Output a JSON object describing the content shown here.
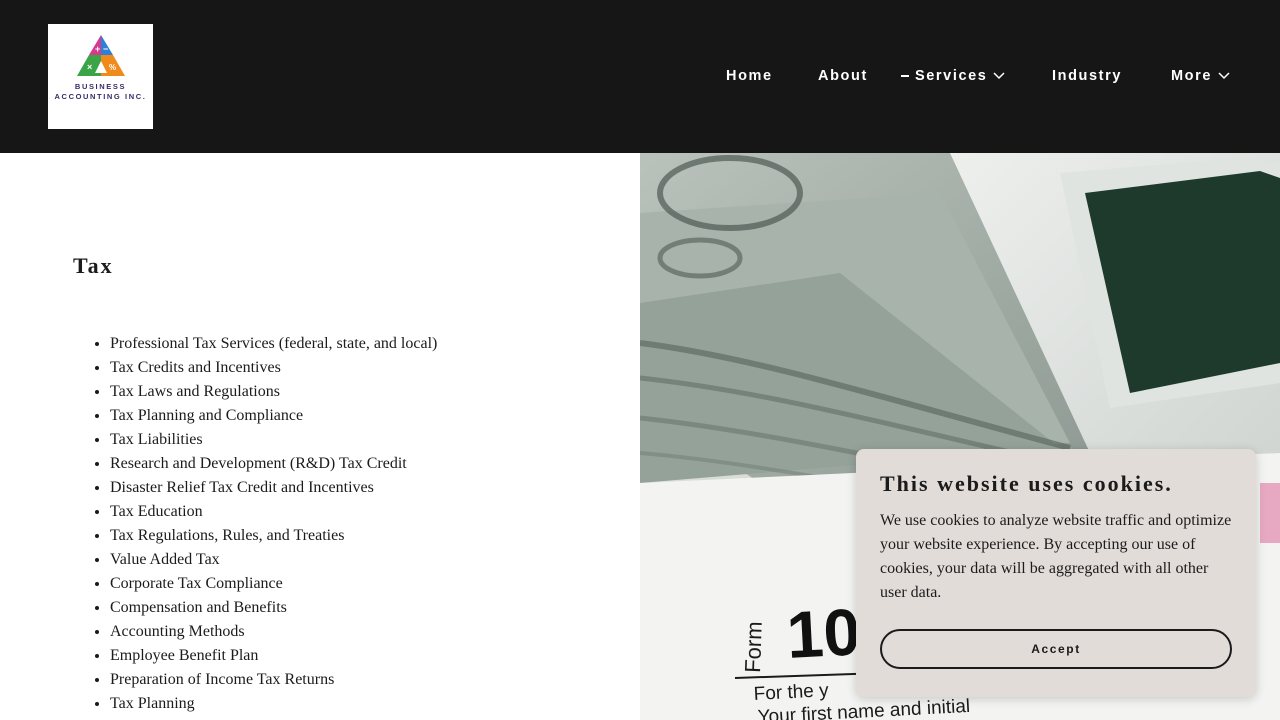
{
  "brand": {
    "logo_text": "BUSINESS ACCOUNTING INC.",
    "logo_symbols": [
      "+",
      "−",
      "×",
      "%"
    ]
  },
  "nav": {
    "items": [
      {
        "label": "Home",
        "has_dropdown": false,
        "active": false
      },
      {
        "label": "About",
        "has_dropdown": false,
        "active": false
      },
      {
        "label": "Services",
        "has_dropdown": true,
        "active": true
      },
      {
        "label": "Industry",
        "has_dropdown": false,
        "active": false
      },
      {
        "label": "More",
        "has_dropdown": true,
        "active": false
      }
    ]
  },
  "section": {
    "title": "Tax",
    "items": [
      "Professional Tax Services (federal, state, and local)",
      "Tax Credits and Incentives",
      "Tax Laws and Regulations",
      "Tax Planning and Compliance",
      "Tax Liabilities",
      "Research and Development (R&D) Tax Credit",
      "Disaster Relief Tax Credit and Incentives",
      "Tax Education",
      "Tax Regulations, Rules, and Treaties",
      "Value Added Tax",
      "Corporate Tax Compliance",
      "Compensation and Benefits",
      "Accounting Methods",
      "Employee Benefit Plan",
      "Preparation of Income Tax Returns",
      "Tax Planning"
    ]
  },
  "hero": {
    "form_label": "Form",
    "form_number": "10",
    "line1": "For the y",
    "line2": "Your first name and initial"
  },
  "cookie": {
    "title": "This website uses cookies.",
    "body": "We use cookies to analyze website traffic and optimize your website experience. By accepting our use of cookies, your data will be aggregated with all other user data.",
    "accept_label": "Accept"
  },
  "colors": {
    "header_bg": "#161616",
    "cookie_bg": "#e2dcd9",
    "text": "#1b1b1b"
  }
}
